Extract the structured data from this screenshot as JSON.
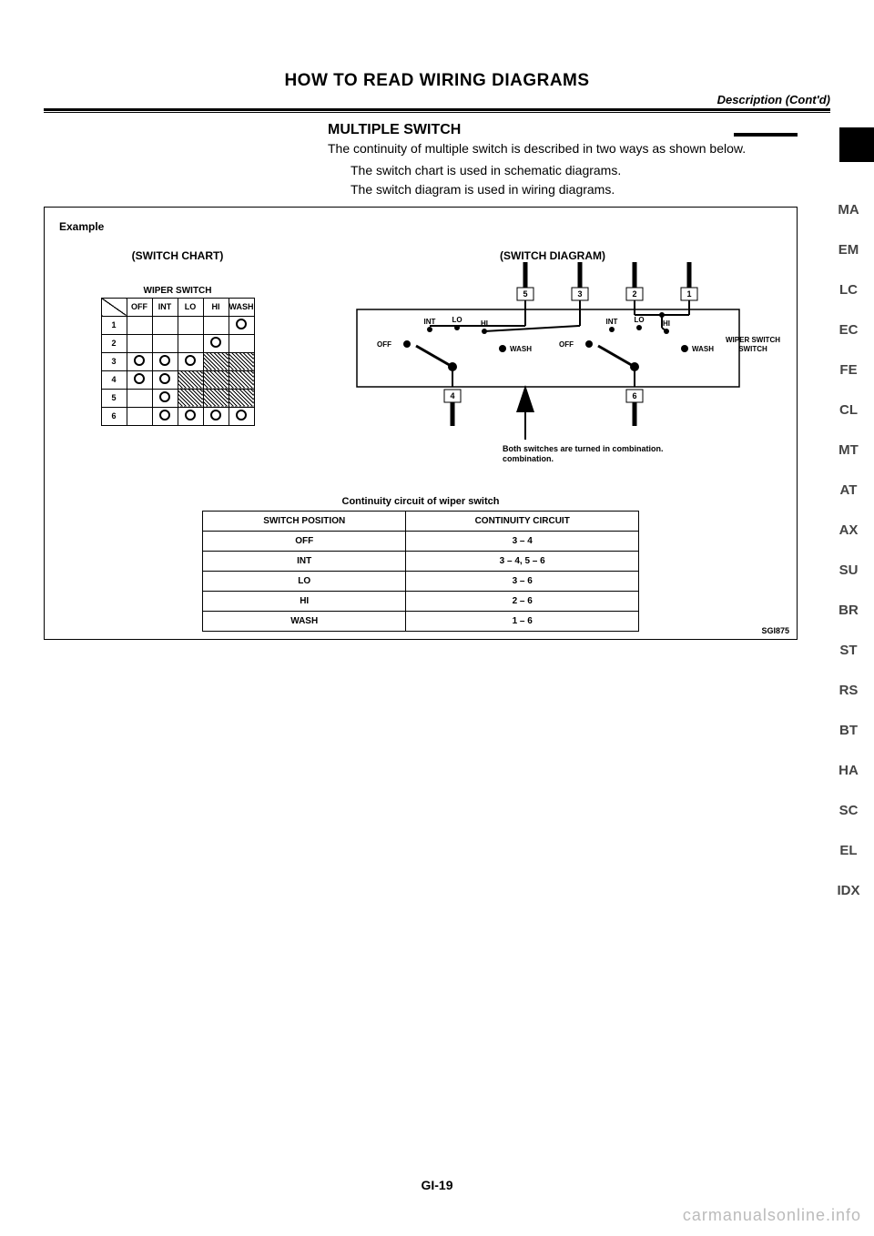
{
  "header": {
    "section_title": "HOW TO READ WIRING DIAGRAMS",
    "subtitle": "Description (Cont'd)"
  },
  "side_index": [
    "MA",
    "EM",
    "LC",
    "EC",
    "FE",
    "CL",
    "MT",
    "AT",
    "AX",
    "SU",
    "BR",
    "ST",
    "RS",
    "BT",
    "HA",
    "SC",
    "EL",
    "IDX"
  ],
  "content": {
    "sub_heading": "MULTIPLE SWITCH",
    "intro": "The continuity of multiple switch is described in two ways as shown below.",
    "bullets": [
      "The switch chart is used in schematic diagrams.",
      "The switch diagram is used in wiring diagrams."
    ]
  },
  "figure": {
    "example_label": "Example",
    "chart_title": "(SWITCH CHART)",
    "wiper_label": "WIPER SWITCH",
    "chart_cols": [
      "OFF",
      "INT",
      "LO",
      "HI",
      "WASH"
    ],
    "chart_rows": [
      "1",
      "2",
      "3",
      "4",
      "5",
      "6"
    ],
    "chart_marks": {
      "1": {
        "WASH": "o"
      },
      "2": {
        "HI": "o"
      },
      "3": {
        "OFF": "o",
        "INT": "o",
        "LO": "o",
        "HI": "h",
        "WASH": "h"
      },
      "4": {
        "OFF": "o",
        "INT": "o",
        "LO": "h",
        "HI": "h",
        "WASH": "h"
      },
      "5": {
        "INT": "o",
        "LO": "h",
        "HI": "h",
        "WASH": "h"
      },
      "6": {
        "INT": "o",
        "LO": "o",
        "HI": "o",
        "WASH": "o"
      }
    },
    "diagram_title": "(SWITCH DIAGRAM)",
    "diagram_labels": {
      "top_terms": [
        "5",
        "3",
        "2",
        "1"
      ],
      "bottom_terms": [
        "4",
        "6"
      ],
      "left_pos": [
        "INT",
        "LO",
        "HI"
      ],
      "off": "OFF",
      "wash": "WASH",
      "right_pos": [
        "INT",
        "LO",
        "HI"
      ],
      "side": "WIPER SWITCH",
      "note": "Both switches are turned in combination."
    },
    "cont_title": "Continuity circuit of wiper switch",
    "cont_headers": [
      "SWITCH POSITION",
      "CONTINUITY CIRCUIT"
    ],
    "cont_rows": [
      {
        "pos": "OFF",
        "circ": "3 – 4"
      },
      {
        "pos": "INT",
        "circ": "3 – 4, 5 – 6"
      },
      {
        "pos": "LO",
        "circ": "3 – 6"
      },
      {
        "pos": "HI",
        "circ": "2 – 6"
      },
      {
        "pos": "WASH",
        "circ": "1 – 6"
      }
    ],
    "code": "SGI875"
  },
  "page_num": "GI-19",
  "watermark": "carmanualsonline.info"
}
